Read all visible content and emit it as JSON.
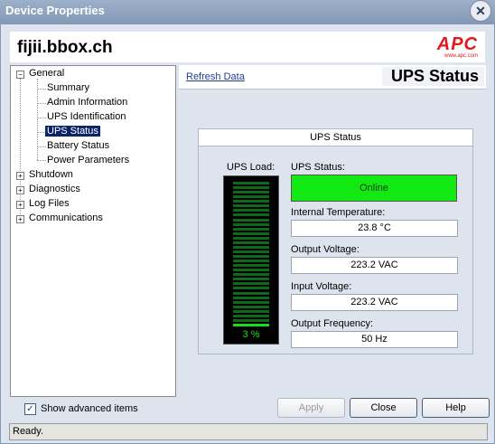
{
  "window": {
    "title": "Device Properties",
    "close_glyph": "✕"
  },
  "header": {
    "hostname": "fijii.bbox.ch",
    "logo_text": "APC",
    "logo_url": "www.apc.com"
  },
  "tree": {
    "general": "General",
    "children": [
      "Summary",
      "Admin Information",
      "UPS Identification",
      "UPS Status",
      "Battery Status",
      "Power Parameters"
    ],
    "selected": "UPS Status",
    "others": [
      "Shutdown",
      "Diagnostics",
      "Log Files",
      "Communications"
    ]
  },
  "panel": {
    "refresh_link": "Refresh Data",
    "title": "UPS Status",
    "box_title": "UPS Status",
    "load_label": "UPS Load:",
    "load_value": "3 %",
    "load_percent": 3,
    "status_label": "UPS Status:",
    "status_value": "Online",
    "temp_label": "Internal Temperature:",
    "temp_value": "23.8 °C",
    "out_voltage_label": "Output Voltage:",
    "out_voltage_value": "223.2 VAC",
    "in_voltage_label": "Input Voltage:",
    "in_voltage_value": "223.2 VAC",
    "freq_label": "Output Frequency:",
    "freq_value": "50 Hz"
  },
  "footer": {
    "advanced_label": "Show advanced items",
    "advanced_checked": true,
    "apply": "Apply",
    "close": "Close",
    "help": "Help",
    "status": "Ready."
  },
  "colors": {
    "online_green": "#12e812",
    "meter_on": "#15e01a",
    "meter_off": "#0c6a1a",
    "apc_red": "#e8161b"
  }
}
